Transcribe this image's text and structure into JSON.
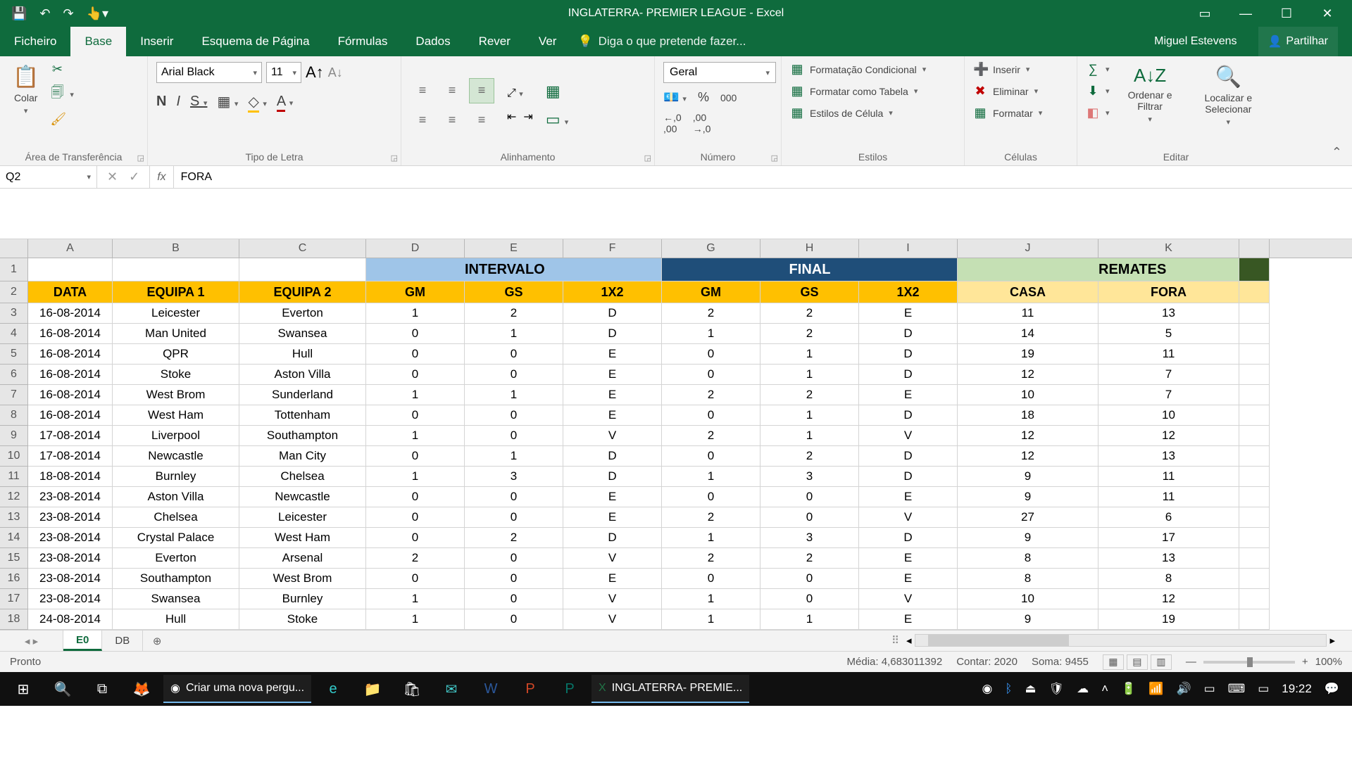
{
  "titlebar": {
    "app_title": "INGLATERRA- PREMIER LEAGUE - Excel"
  },
  "menutabs": {
    "tabs": [
      "Ficheiro",
      "Base",
      "Inserir",
      "Esquema de Página",
      "Fórmulas",
      "Dados",
      "Rever",
      "Ver"
    ],
    "active": "Base",
    "tell_me": "Diga o que pretende fazer...",
    "user": "Miguel Estevens",
    "share": "Partilhar"
  },
  "ribbon": {
    "clipboard": {
      "paste": "Colar",
      "label": "Área de Transferência"
    },
    "font": {
      "name": "Arial Black",
      "size": "11",
      "label": "Tipo de Letra"
    },
    "alignment": {
      "label": "Alinhamento"
    },
    "number": {
      "format": "Geral",
      "thousands": "000",
      "label": "Número"
    },
    "styles": {
      "conditional": "Formatação Condicional",
      "as_table": "Formatar como Tabela",
      "cell_styles": "Estilos de Célula",
      "label": "Estilos"
    },
    "cells": {
      "insert": "Inserir",
      "delete": "Eliminar",
      "format": "Formatar",
      "label": "Células"
    },
    "editing": {
      "sort": "Ordenar e Filtrar",
      "find": "Localizar e Selecionar",
      "label": "Editar"
    }
  },
  "formula_bar": {
    "namebox": "Q2",
    "formula": "FORA"
  },
  "columns": [
    "A",
    "B",
    "C",
    "D",
    "E",
    "F",
    "G",
    "H",
    "I",
    "J",
    "K"
  ],
  "section_headers": {
    "intervalo": "INTERVALO",
    "final": "FINAL",
    "remates": "REMATES"
  },
  "col_headers": {
    "data": "DATA",
    "equipa1": "EQUIPA 1",
    "equipa2": "EQUIPA 2",
    "gm": "GM",
    "gs": "GS",
    "x12": "1X2",
    "casa": "CASA",
    "fora": "FORA"
  },
  "rows": [
    {
      "n": 3,
      "data": "16-08-2014",
      "e1": "Leicester",
      "e2": "Everton",
      "igm": "1",
      "igs": "2",
      "ix": "D",
      "fgm": "2",
      "fgs": "2",
      "fx": "E",
      "casa": "11",
      "fora": "13"
    },
    {
      "n": 4,
      "data": "16-08-2014",
      "e1": "Man United",
      "e2": "Swansea",
      "igm": "0",
      "igs": "1",
      "ix": "D",
      "fgm": "1",
      "fgs": "2",
      "fx": "D",
      "casa": "14",
      "fora": "5"
    },
    {
      "n": 5,
      "data": "16-08-2014",
      "e1": "QPR",
      "e2": "Hull",
      "igm": "0",
      "igs": "0",
      "ix": "E",
      "fgm": "0",
      "fgs": "1",
      "fx": "D",
      "casa": "19",
      "fora": "11"
    },
    {
      "n": 6,
      "data": "16-08-2014",
      "e1": "Stoke",
      "e2": "Aston Villa",
      "igm": "0",
      "igs": "0",
      "ix": "E",
      "fgm": "0",
      "fgs": "1",
      "fx": "D",
      "casa": "12",
      "fora": "7"
    },
    {
      "n": 7,
      "data": "16-08-2014",
      "e1": "West Brom",
      "e2": "Sunderland",
      "igm": "1",
      "igs": "1",
      "ix": "E",
      "fgm": "2",
      "fgs": "2",
      "fx": "E",
      "casa": "10",
      "fora": "7"
    },
    {
      "n": 8,
      "data": "16-08-2014",
      "e1": "West Ham",
      "e2": "Tottenham",
      "igm": "0",
      "igs": "0",
      "ix": "E",
      "fgm": "0",
      "fgs": "1",
      "fx": "D",
      "casa": "18",
      "fora": "10"
    },
    {
      "n": 9,
      "data": "17-08-2014",
      "e1": "Liverpool",
      "e2": "Southampton",
      "igm": "1",
      "igs": "0",
      "ix": "V",
      "fgm": "2",
      "fgs": "1",
      "fx": "V",
      "casa": "12",
      "fora": "12"
    },
    {
      "n": 10,
      "data": "17-08-2014",
      "e1": "Newcastle",
      "e2": "Man City",
      "igm": "0",
      "igs": "1",
      "ix": "D",
      "fgm": "0",
      "fgs": "2",
      "fx": "D",
      "casa": "12",
      "fora": "13"
    },
    {
      "n": 11,
      "data": "18-08-2014",
      "e1": "Burnley",
      "e2": "Chelsea",
      "igm": "1",
      "igs": "3",
      "ix": "D",
      "fgm": "1",
      "fgs": "3",
      "fx": "D",
      "casa": "9",
      "fora": "11"
    },
    {
      "n": 12,
      "data": "23-08-2014",
      "e1": "Aston Villa",
      "e2": "Newcastle",
      "igm": "0",
      "igs": "0",
      "ix": "E",
      "fgm": "0",
      "fgs": "0",
      "fx": "E",
      "casa": "9",
      "fora": "11"
    },
    {
      "n": 13,
      "data": "23-08-2014",
      "e1": "Chelsea",
      "e2": "Leicester",
      "igm": "0",
      "igs": "0",
      "ix": "E",
      "fgm": "2",
      "fgs": "0",
      "fx": "V",
      "casa": "27",
      "fora": "6"
    },
    {
      "n": 14,
      "data": "23-08-2014",
      "e1": "Crystal Palace",
      "e2": "West Ham",
      "igm": "0",
      "igs": "2",
      "ix": "D",
      "fgm": "1",
      "fgs": "3",
      "fx": "D",
      "casa": "9",
      "fora": "17"
    },
    {
      "n": 15,
      "data": "23-08-2014",
      "e1": "Everton",
      "e2": "Arsenal",
      "igm": "2",
      "igs": "0",
      "ix": "V",
      "fgm": "2",
      "fgs": "2",
      "fx": "E",
      "casa": "8",
      "fora": "13"
    },
    {
      "n": 16,
      "data": "23-08-2014",
      "e1": "Southampton",
      "e2": "West Brom",
      "igm": "0",
      "igs": "0",
      "ix": "E",
      "fgm": "0",
      "fgs": "0",
      "fx": "E",
      "casa": "8",
      "fora": "8"
    },
    {
      "n": 17,
      "data": "23-08-2014",
      "e1": "Swansea",
      "e2": "Burnley",
      "igm": "1",
      "igs": "0",
      "ix": "V",
      "fgm": "1",
      "fgs": "0",
      "fx": "V",
      "casa": "10",
      "fora": "12"
    },
    {
      "n": 18,
      "data": "24-08-2014",
      "e1": "Hull",
      "e2": "Stoke",
      "igm": "1",
      "igs": "0",
      "ix": "V",
      "fgm": "1",
      "fgs": "1",
      "fx": "E",
      "casa": "9",
      "fora": "19"
    }
  ],
  "sheets": {
    "active": "E0",
    "other": "DB"
  },
  "statusbar": {
    "ready": "Pronto",
    "avg_label": "Média:",
    "avg": "4,683011392",
    "count_label": "Contar:",
    "count": "2020",
    "sum_label": "Soma:",
    "sum": "9455",
    "zoom": "100%"
  },
  "taskbar": {
    "chrome_title": "Criar uma nova pergu...",
    "excel_title": "INGLATERRA- PREMIE...",
    "clock": "19:22"
  }
}
